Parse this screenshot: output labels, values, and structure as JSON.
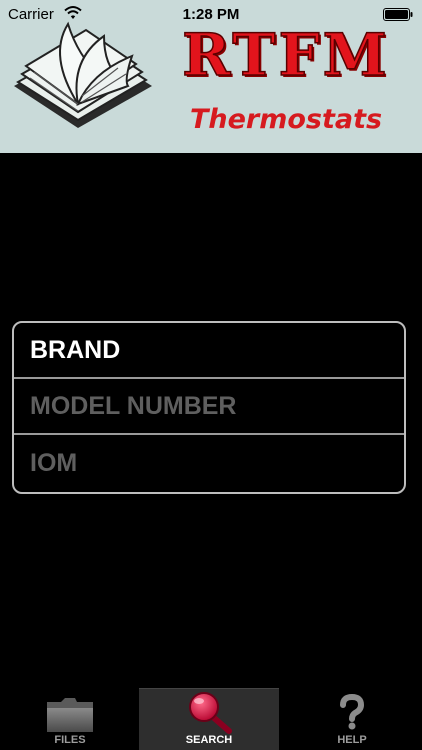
{
  "status_bar": {
    "carrier": "Carrier",
    "time": "1:28 PM"
  },
  "header": {
    "logo_title": "RTFM",
    "logo_subtitle": "Thermostats",
    "icon": "open-book-icon"
  },
  "criteria": {
    "items": [
      {
        "label": "BRAND",
        "active": true
      },
      {
        "label": "MODEL NUMBER",
        "active": false
      },
      {
        "label": "IOM",
        "active": false
      }
    ]
  },
  "tab_bar": {
    "selected": "SEARCH",
    "tabs": [
      {
        "label": "FILES",
        "icon": "folder-icon"
      },
      {
        "label": "SEARCH",
        "icon": "magnifier-icon"
      },
      {
        "label": "HELP",
        "icon": "question-mark-icon"
      }
    ]
  },
  "colors": {
    "banner_bg": "#c9dad9",
    "logo_red": "#e2141c",
    "background": "#000000",
    "active_text": "#ffffff",
    "inactive_text": "#5f5f5f"
  }
}
